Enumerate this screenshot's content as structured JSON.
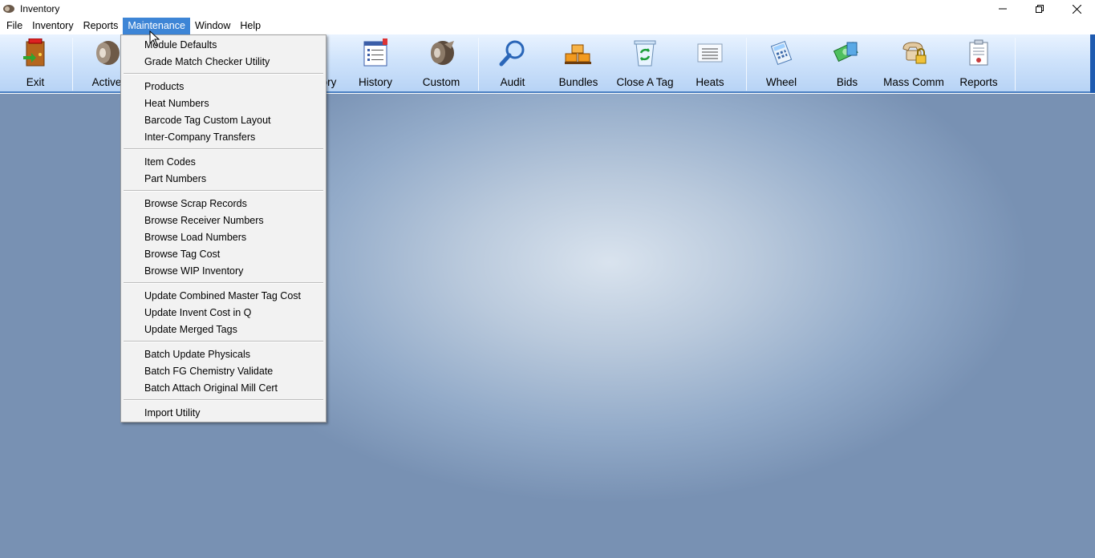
{
  "window": {
    "title": "Inventory",
    "controls": [
      "minimize-icon",
      "restore-icon",
      "close-icon"
    ]
  },
  "menubar": [
    {
      "label": "File"
    },
    {
      "label": "Inventory"
    },
    {
      "label": "Reports"
    },
    {
      "label": "Maintenance",
      "active": true
    },
    {
      "label": "Window"
    },
    {
      "label": "Help"
    }
  ],
  "toolbar": {
    "buttons": [
      {
        "label": "Exit",
        "icon": "exit-door-icon"
      },
      {
        "label": "Active",
        "icon": "coil-icon"
      },
      {
        "label": "ory",
        "icon": ""
      },
      {
        "label": "History",
        "icon": "history-list-icon"
      },
      {
        "label": "Custom",
        "icon": "coil-custom-icon"
      },
      {
        "label": "Audit",
        "icon": "magnifier-icon"
      },
      {
        "label": "Bundles",
        "icon": "bundles-icon"
      },
      {
        "label": "Close A Tag",
        "icon": "recycle-bin-icon"
      },
      {
        "label": "Heats",
        "icon": "heats-list-icon"
      },
      {
        "label": "Wheel",
        "icon": "calculator-icon"
      },
      {
        "label": "Bids",
        "icon": "bids-money-icon"
      },
      {
        "label": "Mass Comm",
        "icon": "phone-lock-icon"
      },
      {
        "label": "Reports",
        "icon": "report-icon"
      }
    ]
  },
  "maintenance_menu": {
    "groups": [
      [
        "Module Defaults",
        "Grade Match Checker Utility"
      ],
      [
        "Products",
        "Heat Numbers",
        "Barcode Tag Custom Layout",
        "Inter-Company Transfers"
      ],
      [
        "Item Codes",
        "Part Numbers"
      ],
      [
        "Browse Scrap Records",
        "Browse Receiver Numbers",
        "Browse Load Numbers",
        "Browse Tag Cost",
        "Browse WIP Inventory"
      ],
      [
        "Update Combined Master Tag Cost",
        "Update Invent Cost in Q",
        "Update Merged Tags"
      ],
      [
        "Batch Update Physicals",
        "Batch FG Chemistry Validate",
        "Batch Attach Original Mill Cert"
      ],
      [
        "Import Utility"
      ]
    ]
  },
  "colors": {
    "menu_active": "#3d85d6",
    "toolbar_edge": "#1f5bb0"
  }
}
